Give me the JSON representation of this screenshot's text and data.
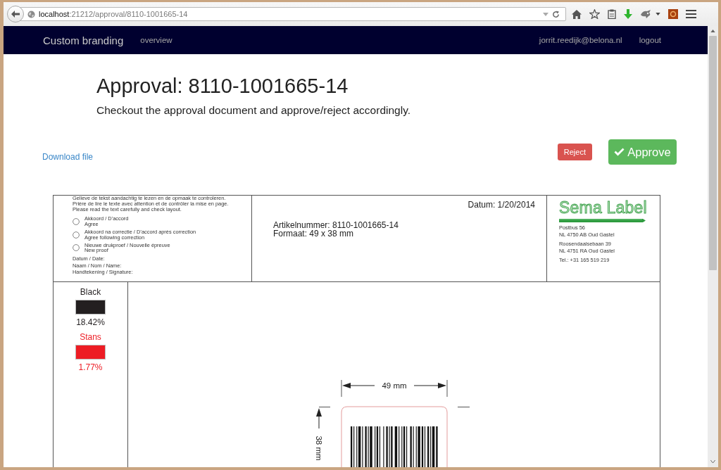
{
  "browser": {
    "url_host": "localhost",
    "url_path": ":21212/approval/8110-1001665-14"
  },
  "navbar": {
    "brand": "Custom branding",
    "links": [
      "overview"
    ],
    "user": "jorrit.reedijk@belona.nl",
    "logout": "logout"
  },
  "page": {
    "title": "Approval: 8110-1001665-14",
    "subtitle": "Checkout the approval document and approve/reject accordingly.",
    "download_link": "Download file",
    "buttons": [
      {
        "kind": "reject",
        "label": "Reject"
      },
      {
        "kind": "approve",
        "label": "Approve"
      }
    ]
  },
  "document": {
    "instructions": [
      "Gelieve de tekst aandachtig te lezen en de opmaak te controleren.",
      "Prière de lire le texte avec attention et de contrôler la mise en page.",
      "Please read the text carefully and check layout."
    ],
    "options": [
      {
        "label": "Akkoord / D’accord",
        "sublabel": "Agree",
        "selected": false
      },
      {
        "label": "Akkoord na correctie / D’accord après correction",
        "sublabel": "Agree following correction",
        "selected": false
      },
      {
        "label": "Nieuwe drukproef / Nouvelle épreuve",
        "sublabel": "New proof",
        "selected": false
      }
    ],
    "fields": [
      "Datum / Date:",
      "Naam / Nom / Name:",
      "Handtekening / Signature:"
    ],
    "date": "Datum: 1/20/2014",
    "article_number": "Artikelnummer: 8110-1001665-14",
    "format": "Formaat: 49 x 38 mm",
    "company": {
      "logo": "Sema Label",
      "address": [
        [
          "Postbus 56",
          "NL 4750 AB Oud Gastel"
        ],
        [
          "Roosendaalsebaan 39",
          "NL 4751 RA Oud Gastel"
        ],
        [
          "Tel.: +31 165 519 219"
        ]
      ]
    },
    "colors": [
      {
        "name": "Black",
        "color": "#231f20",
        "coverage": "18.42%"
      },
      {
        "name": "Stans",
        "color": "#ed1c24",
        "coverage": "1.77%"
      }
    ],
    "label": {
      "width": "49 mm",
      "height": "38 mm"
    }
  }
}
